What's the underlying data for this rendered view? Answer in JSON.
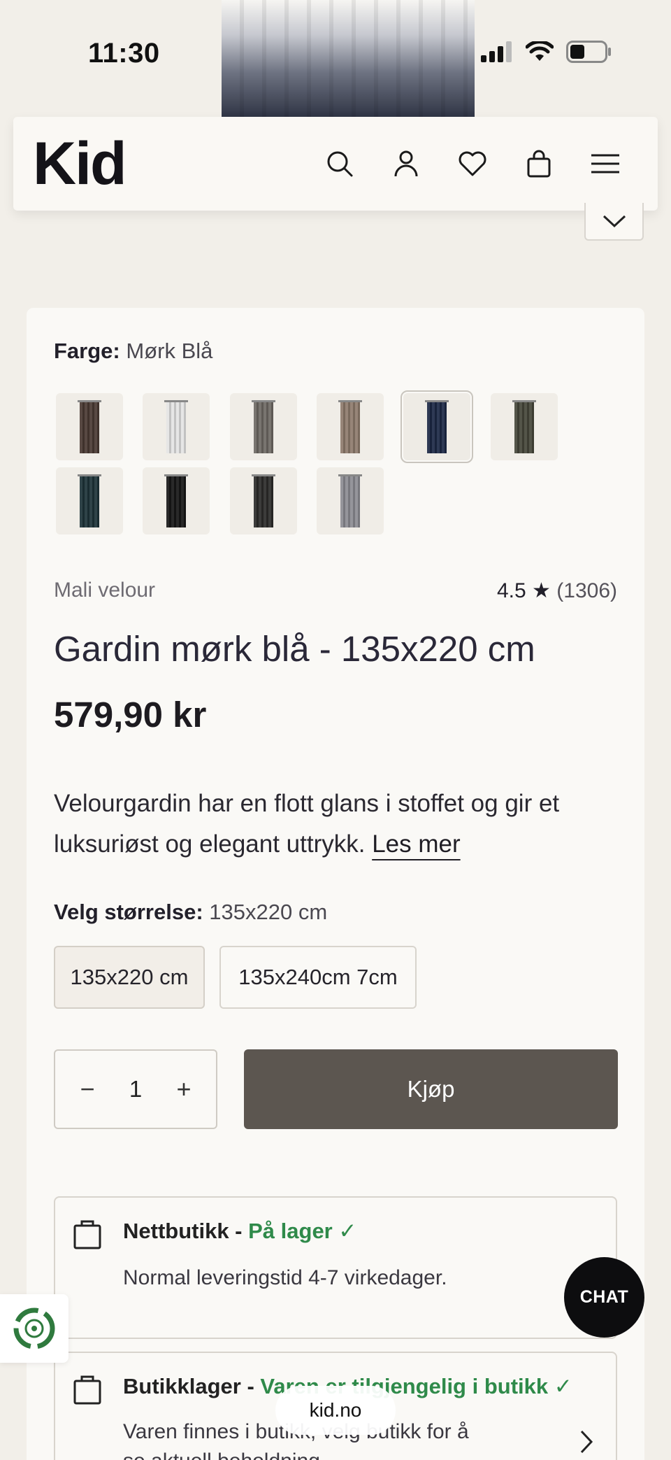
{
  "status_bar": {
    "time": "11:30"
  },
  "header": {
    "logo": "Kid",
    "icons": [
      "search-icon",
      "account-icon",
      "wishlist-heart-icon",
      "shopping-bag-icon",
      "menu-icon"
    ]
  },
  "product": {
    "color_label": "Farge:",
    "color_value": "Mørk Blå",
    "swatches": [
      {
        "name": "brown",
        "color": "#4a3a33"
      },
      {
        "name": "white",
        "color": "#e4e4e4"
      },
      {
        "name": "grey",
        "color": "#6e6964"
      },
      {
        "name": "beige",
        "color": "#8e7b6c"
      },
      {
        "name": "dark-blue",
        "color": "#1c2845",
        "selected": true
      },
      {
        "name": "olive-green",
        "color": "#46473a"
      },
      {
        "name": "dark-teal",
        "color": "#1d3338"
      },
      {
        "name": "black",
        "color": "#171717"
      },
      {
        "name": "charcoal",
        "color": "#2c2b2a"
      },
      {
        "name": "light-grey",
        "color": "#8c8c93"
      }
    ],
    "collection": "Mali velour",
    "rating": "4.5 ★",
    "rating_count": "(1306)",
    "title": "Gardin mørk blå - 135x220 cm",
    "price": "579,90 kr",
    "description": "Velourgardin har en flott glans i stoffet og gir et luksuriøst og elegant uttrykk.",
    "read_more": "Les mer",
    "size_label": "Velg størrelse:",
    "size_value": "135x220 cm",
    "sizes": [
      "135x220 cm",
      "135x240cm 7cm"
    ],
    "quantity": "1",
    "quantity_minus": "−",
    "quantity_plus": "+",
    "buy_label": "Kjøp"
  },
  "stock": {
    "online": {
      "label": "Nettbutikk -",
      "status": "På lager ✓",
      "note": "Normal leveringstid 4-7 virkedager."
    },
    "store": {
      "label": "Butikklager -",
      "status": "Varen er tilgjengelig i butikk ✓",
      "note_line1": "Varen finnes i butikk, velg butikk for å",
      "note_line2": "se aktuell beholdning"
    }
  },
  "chat_label": "CHAT",
  "url": "kid.no",
  "colors": {
    "accent_buy": "#5c5650",
    "in_stock_green": "#2f8a4a",
    "background": "#f2efe9"
  }
}
